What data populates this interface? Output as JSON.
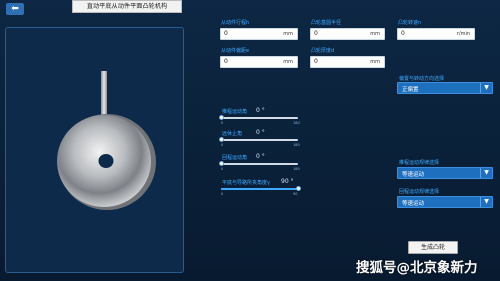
{
  "header": {
    "back_icon": "back-arrow-icon",
    "title": "直动平底从动件平面凸轮机构"
  },
  "inputs": {
    "col1_row1": {
      "label": "从动件行程h",
      "value": "0",
      "unit": "mm"
    },
    "col2_row1": {
      "label": "凸轮基圆半径",
      "value": "0",
      "unit": "mm"
    },
    "col3_row1": {
      "label": "凸轮转速n",
      "value": "0",
      "unit": "r/min"
    },
    "col1_row2": {
      "label": "从动件偏距e",
      "value": "0",
      "unit": "mm"
    },
    "col2_row2": {
      "label": "凸轮厚度d",
      "value": "0",
      "unit": "mm"
    }
  },
  "dropdowns": {
    "direction": {
      "label": "偏置与转动方向选择",
      "value": "正偏置"
    },
    "rise_motion": {
      "label": "推程运动规律选择",
      "value": "等速运动"
    },
    "return_motion": {
      "label": "回程运动规律选择",
      "value": "等速运动"
    }
  },
  "sliders": [
    {
      "label": "推程运动角",
      "value": "0",
      "unit": "°",
      "min": "0",
      "max": "180",
      "fraction": 0.0
    },
    {
      "label": "远休止角",
      "value": "0",
      "unit": "°",
      "min": "0",
      "max": "180",
      "fraction": 0.0
    },
    {
      "label": "回程运动角",
      "value": "0",
      "unit": "°",
      "min": "0",
      "max": "180",
      "fraction": 0.0
    },
    {
      "label": "平底与导路所夹角度γ",
      "value": "90",
      "unit": "°",
      "min": "0",
      "max": "90",
      "fraction": 1.0
    }
  ],
  "actions": {
    "generate": "生成凸轮"
  },
  "watermark": "搜狐号@北京象新力",
  "colors": {
    "accent": "#3fa9ff",
    "background": "#0d2744",
    "dropdown": "#1f6fbf"
  }
}
